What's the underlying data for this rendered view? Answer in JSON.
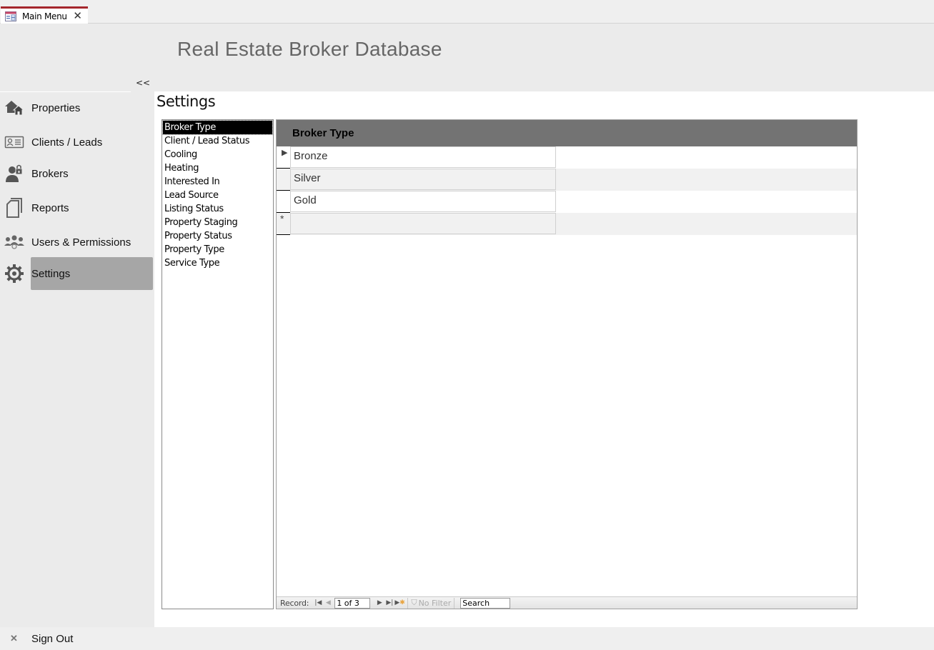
{
  "tabs": [
    {
      "label": "Main Menu",
      "icon": "form-icon",
      "active": true
    }
  ],
  "header": {
    "title": "Real Estate Broker Database",
    "collapse_label": "<<"
  },
  "nav": {
    "items": [
      {
        "label": "Properties",
        "icon": "houses-icon",
        "active": false
      },
      {
        "label": "Clients / Leads",
        "icon": "contact-card-icon",
        "active": false
      },
      {
        "label": "Brokers",
        "icon": "broker-lock-icon",
        "active": false
      },
      {
        "label": "Reports",
        "icon": "report-pages-icon",
        "active": false
      },
      {
        "label": "Users & Permissions",
        "icon": "user-group-icon",
        "active": false
      },
      {
        "label": "Settings",
        "icon": "gear-icon",
        "active": true
      }
    ],
    "sign_out": {
      "label": "Sign Out",
      "icon": "close-x-icon"
    }
  },
  "page": {
    "title": "Settings"
  },
  "settings_list": {
    "items": [
      "Broker Type",
      "Client / Lead Status",
      "Cooling",
      "Heating",
      "Interested In",
      "Lead Source",
      "Listing Status",
      "Property Staging",
      "Property Status",
      "Property Type",
      "Service Type"
    ],
    "selected": "Broker Type"
  },
  "subform": {
    "column_header": "Broker Type",
    "rows": [
      {
        "value": "Bronze",
        "current": true
      },
      {
        "value": "Silver",
        "current": false
      },
      {
        "value": "Gold",
        "current": false
      }
    ],
    "new_row_marker": "*",
    "current_marker": "▶"
  },
  "record_nav": {
    "label": "Record:",
    "position": "1 of 3",
    "filter_label": "No Filter",
    "search_placeholder": "Search"
  },
  "colors": {
    "accent_tab": "#a4262c",
    "header_band": "#ebebeb",
    "subform_header": "#737373",
    "nav_active": "#a6a6a6"
  }
}
